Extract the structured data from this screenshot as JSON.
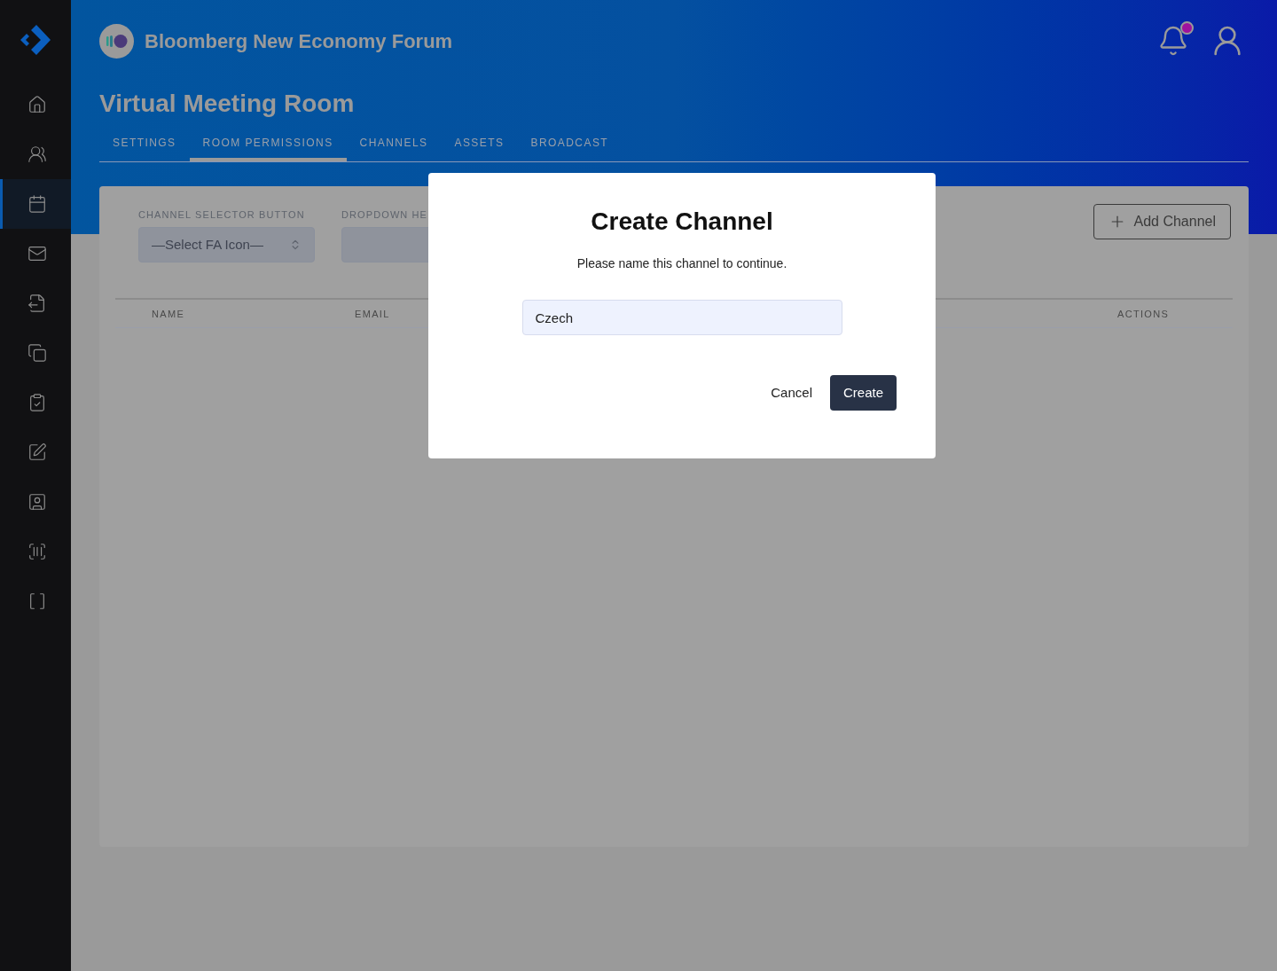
{
  "sidebar": {
    "items": [
      {
        "selected": false
      },
      {
        "selected": false
      },
      {
        "selected": true
      },
      {
        "selected": false
      },
      {
        "selected": false
      },
      {
        "selected": false
      },
      {
        "selected": false
      },
      {
        "selected": false
      },
      {
        "selected": false
      },
      {
        "selected": false
      },
      {
        "selected": false
      }
    ]
  },
  "header": {
    "organization": "Bloomberg New Economy Forum",
    "notifications": {
      "unread": true
    }
  },
  "page": {
    "title": "Virtual Meeting Room"
  },
  "tabs": [
    {
      "label": "SETTINGS",
      "selected": false
    },
    {
      "label": "ROOM PERMISSIONS",
      "selected": true
    },
    {
      "label": "CHANNELS",
      "selected": false
    },
    {
      "label": "ASSETS",
      "selected": false
    },
    {
      "label": "BROADCAST",
      "selected": false
    }
  ],
  "form": {
    "fields": [
      {
        "label": "CHANNEL SELECTOR BUTTON",
        "value": "—Select FA Icon—",
        "kind": "select"
      },
      {
        "label": "DROPDOWN HE",
        "kind": "input"
      }
    ],
    "add_button": "Add Channel"
  },
  "table": {
    "columns": [
      "NAME",
      "EMAIL",
      "ACTIONS"
    ]
  },
  "dialog": {
    "title": "Create Channel",
    "message": "Please name this channel to continue.",
    "input_value": "Czech",
    "buttons": [
      "Cancel",
      "Create"
    ]
  }
}
